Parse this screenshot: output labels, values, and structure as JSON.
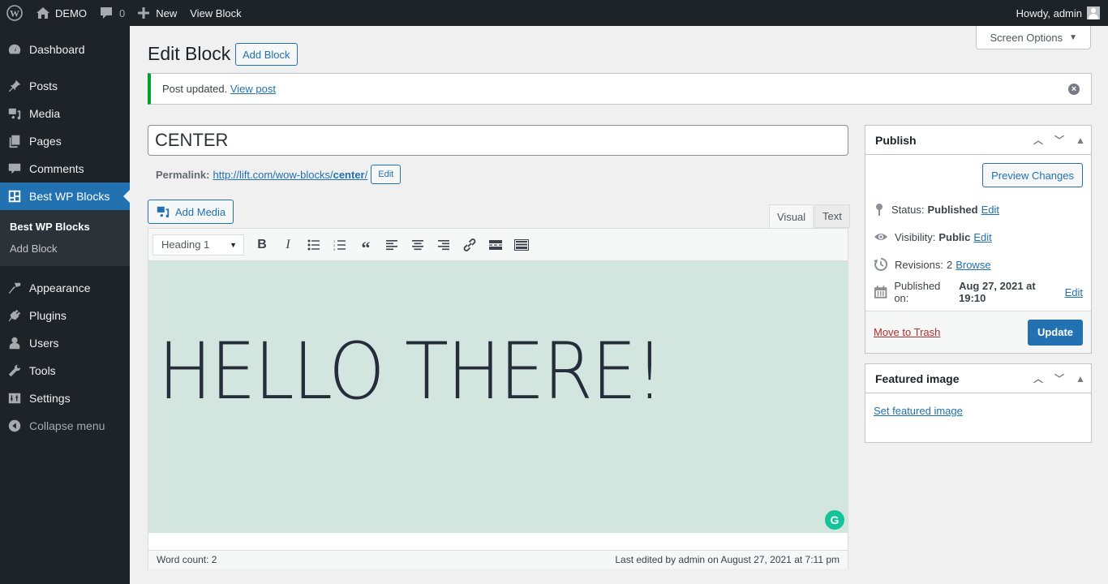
{
  "adminbar": {
    "site_name": "DEMO",
    "comments_count": "0",
    "new_label": "New",
    "view_label": "View Block",
    "greeting": "Howdy, admin"
  },
  "sidebar": {
    "items": [
      {
        "label": "Dashboard",
        "icon": "dashboard-icon"
      },
      {
        "label": "Posts",
        "icon": "pin-icon"
      },
      {
        "label": "Media",
        "icon": "media-icon"
      },
      {
        "label": "Pages",
        "icon": "pages-icon"
      },
      {
        "label": "Comments",
        "icon": "comment-icon"
      },
      {
        "label": "Best WP Blocks",
        "icon": "blocks-icon",
        "active": true
      },
      {
        "label": "Appearance",
        "icon": "brush-icon"
      },
      {
        "label": "Plugins",
        "icon": "plug-icon"
      },
      {
        "label": "Users",
        "icon": "user-icon"
      },
      {
        "label": "Tools",
        "icon": "wrench-icon"
      },
      {
        "label": "Settings",
        "icon": "settings-icon"
      }
    ],
    "submenu": [
      "Best WP Blocks",
      "Add Block"
    ],
    "collapse_label": "Collapse menu"
  },
  "header": {
    "screen_options": "Screen Options",
    "title": "Edit Block",
    "add_button": "Add Block"
  },
  "notice": {
    "text": "Post updated.",
    "link": "View post"
  },
  "post": {
    "title": "CENTER",
    "permalink_label": "Permalink:",
    "permalink_base": "http://lift.com/wow-blocks/",
    "permalink_slug": "center",
    "permalink_end": "/",
    "permalink_edit": "Edit"
  },
  "editor": {
    "add_media": "Add Media",
    "tabs": [
      "Visual",
      "Text"
    ],
    "format": "Heading 1",
    "content_heading": "HELLO THERE!",
    "grammarly_letter": "G",
    "word_count": "Word count: 2",
    "last_edited": "Last edited by admin on August 27, 2021 at 7:11 pm"
  },
  "publish": {
    "title": "Publish",
    "preview": "Preview Changes",
    "status_label": "Status:",
    "status_value": "Published",
    "visibility_label": "Visibility:",
    "visibility_value": "Public",
    "revisions_label": "Revisions:",
    "revisions_value": "2",
    "revisions_link": "Browse",
    "published_label": "Published on:",
    "published_value": "Aug 27, 2021 at 19:10",
    "edit": "Edit",
    "trash": "Move to Trash",
    "update": "Update"
  },
  "featured": {
    "title": "Featured image",
    "link": "Set featured image"
  },
  "colors": {
    "accent": "#2271b1",
    "sidebar_bg": "#1d2327",
    "notice_success": "#00a32a",
    "editor_bg": "#d2e5df",
    "grammarly": "#15c39a",
    "trash": "#b32d2e"
  }
}
